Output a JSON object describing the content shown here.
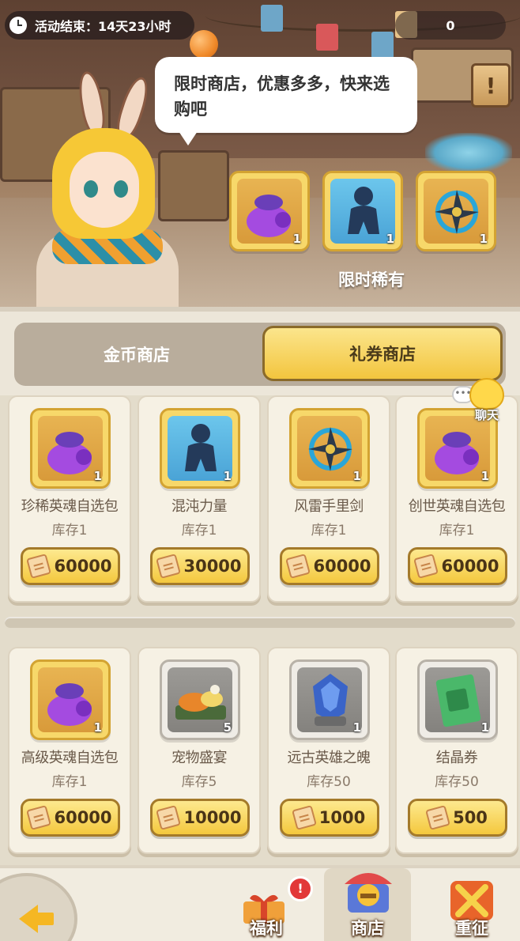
{
  "banner": {
    "event_timer": "活动结束：14天23小时",
    "currency_value": "0",
    "npc_speech": "限时商店，优惠多多，快来选购吧",
    "rare_label": "限时稀有",
    "info_symbol": "!",
    "rare_items": [
      {
        "icon": "purple-bag-icon",
        "count": "1"
      },
      {
        "icon": "shadow-figure-icon",
        "count": "1"
      },
      {
        "icon": "shuriken-icon",
        "count": "1"
      }
    ]
  },
  "tabs": {
    "gold_shop": "金币商店",
    "coupon_shop": "礼券商店",
    "active": "coupon_shop"
  },
  "chat": {
    "label": "聊天",
    "dots": "•••"
  },
  "items": [
    {
      "name": "珍稀英魂自选包",
      "stock": "库存1",
      "price": "60000",
      "count": "1",
      "icon": "purple-bag-icon"
    },
    {
      "name": "混沌力量",
      "stock": "库存1",
      "price": "30000",
      "count": "1",
      "icon": "shadow-figure-icon"
    },
    {
      "name": "风雷手里剑",
      "stock": "库存1",
      "price": "60000",
      "count": "1",
      "icon": "shuriken-icon"
    },
    {
      "name": "创世英魂自选包",
      "stock": "库存1",
      "price": "60000",
      "count": "1",
      "icon": "purple-bag-icon"
    },
    {
      "name": "高级英魂自选包",
      "stock": "库存1",
      "price": "60000",
      "count": "1",
      "icon": "purple-bag-icon"
    },
    {
      "name": "宠物盛宴",
      "stock": "库存5",
      "price": "10000",
      "count": "5",
      "icon": "feast-tray-icon"
    },
    {
      "name": "远古英雄之魄",
      "stock": "库存50",
      "price": "1000",
      "count": "1",
      "icon": "blue-crystal-icon"
    },
    {
      "name": "结晶券",
      "stock": "库存50",
      "price": "500",
      "count": "1",
      "icon": "green-ticket-icon"
    }
  ],
  "nav": {
    "welfare": "福利",
    "shop": "商店",
    "expedition": "重征",
    "active": "shop"
  },
  "colors": {
    "gold_button": "#f4c83e",
    "card_bg": "#f6f1e4",
    "tab_track": "#b9ad9c"
  }
}
